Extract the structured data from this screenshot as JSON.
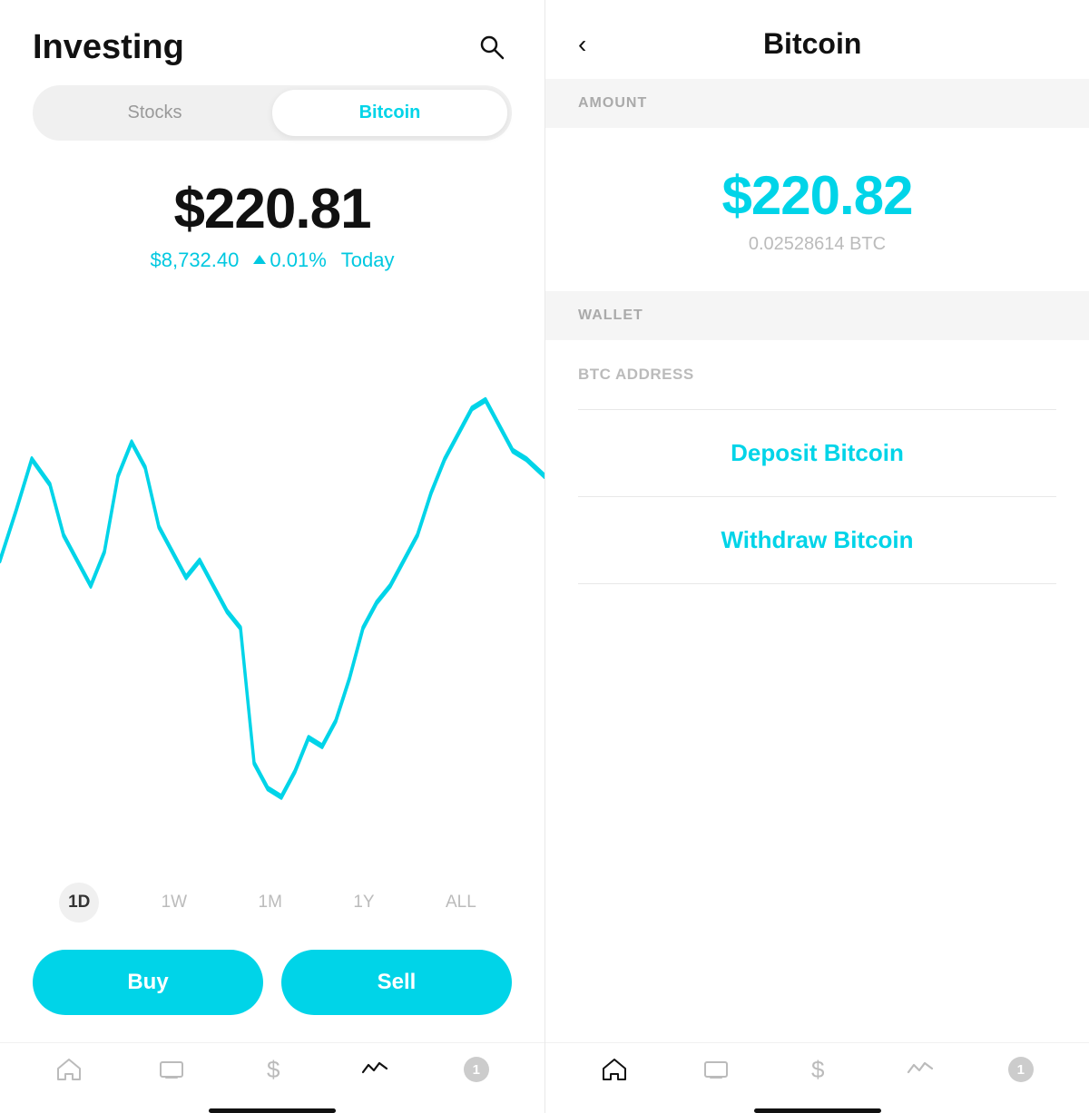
{
  "left": {
    "header": {
      "title": "Investing",
      "search_label": "search"
    },
    "tabs": [
      {
        "id": "stocks",
        "label": "Stocks",
        "active": false
      },
      {
        "id": "bitcoin",
        "label": "Bitcoin",
        "active": true
      }
    ],
    "price": {
      "main": "$220.81",
      "btc_price": "$8,732.40",
      "change": "0.01%",
      "period": "Today"
    },
    "time_ranges": [
      {
        "label": "1D",
        "active": true
      },
      {
        "label": "1W",
        "active": false
      },
      {
        "label": "1M",
        "active": false
      },
      {
        "label": "1Y",
        "active": false
      },
      {
        "label": "ALL",
        "active": false
      }
    ],
    "buttons": {
      "buy": "Buy",
      "sell": "Sell"
    },
    "nav": [
      {
        "icon": "home",
        "label": "home",
        "active": false
      },
      {
        "icon": "tv",
        "label": "tv",
        "active": false
      },
      {
        "icon": "dollar",
        "label": "dollar",
        "active": false
      },
      {
        "icon": "activity",
        "label": "activity",
        "active": true
      },
      {
        "icon": "notification",
        "label": "1",
        "active": false
      }
    ]
  },
  "right": {
    "header": {
      "title": "Bitcoin",
      "back": "<"
    },
    "amount_section": {
      "label": "AMOUNT",
      "value": "$220.82",
      "btc": "0.02528614 BTC"
    },
    "wallet_section": {
      "label": "WALLET",
      "btc_address_label": "BTC ADDRESS"
    },
    "actions": [
      {
        "label": "Deposit Bitcoin",
        "id": "deposit"
      },
      {
        "label": "Withdraw Bitcoin",
        "id": "withdraw"
      }
    ],
    "nav": [
      {
        "icon": "home",
        "label": "home",
        "active": true
      },
      {
        "icon": "tv",
        "label": "tv",
        "active": false
      },
      {
        "icon": "dollar",
        "label": "dollar",
        "active": false
      },
      {
        "icon": "activity",
        "label": "activity",
        "active": false
      },
      {
        "icon": "notification",
        "label": "1",
        "active": false
      }
    ]
  },
  "accent_color": "#00d4e8",
  "colors": {
    "active_nav": "#111111",
    "inactive_nav": "#bbbbbb",
    "badge_bg": "#cccccc"
  }
}
